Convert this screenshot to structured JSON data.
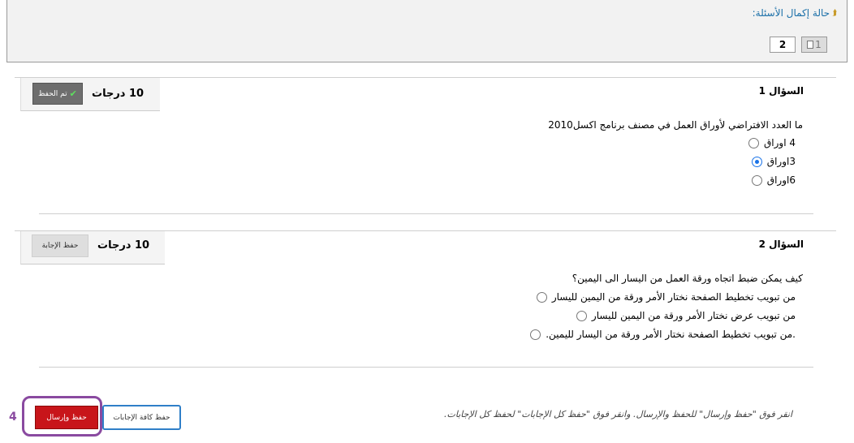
{
  "status_panel": {
    "title": "حالة إكمال الأسئلة:",
    "question_buttons": [
      {
        "label": "1",
        "state": "saved"
      },
      {
        "label": "2",
        "state": "current"
      }
    ]
  },
  "questions": [
    {
      "header": "السؤال 1",
      "grade": "10 درجات",
      "button_label": "تم الحفظ",
      "button_state": "saved",
      "text": "ما العدد الافتراضي لأوراق العمل في مصنف برنامج اكسل2010",
      "options": [
        {
          "label": "4 اوراق",
          "checked": false
        },
        {
          "label": "3اوراق",
          "checked": true
        },
        {
          "label": "6اوراق",
          "checked": false
        }
      ]
    },
    {
      "header": "السؤال 2",
      "grade": "10 درجات",
      "button_label": "حفظ الإجابة",
      "button_state": "unsaved",
      "text": "كيف يمكن ضبط اتجاه ورقة العمل من اليسار الى اليمين؟",
      "options": [
        {
          "label": "من تبويب تخطيط الصفحة نختار الأمر ورقة من اليمين لليسار",
          "checked": false
        },
        {
          "label": "من تبويب عرض نختار الأمر ورقة من اليمين لليسار",
          "checked": false
        },
        {
          "label": ".من تبويب تخطيط الصفحة نختار الأمر ورقة من اليسار لليمين.",
          "checked": false
        }
      ]
    }
  ],
  "footer": {
    "hint": "انقر فوق \"حفظ وإرسال\" للحفظ والإرسال. وانقر فوق \"حفظ كل الإجابات\" لحفظ كل الإجابات.",
    "save_all_label": "حفظ كافة الإجابات",
    "submit_label": "حفظ وإرسال",
    "annotation_number": "4"
  },
  "colors": {
    "link_blue": "#1a6fa8",
    "submit_red": "#c8151a",
    "highlight_purple": "#8a4aa0",
    "radio_blue": "#1a73e8"
  }
}
